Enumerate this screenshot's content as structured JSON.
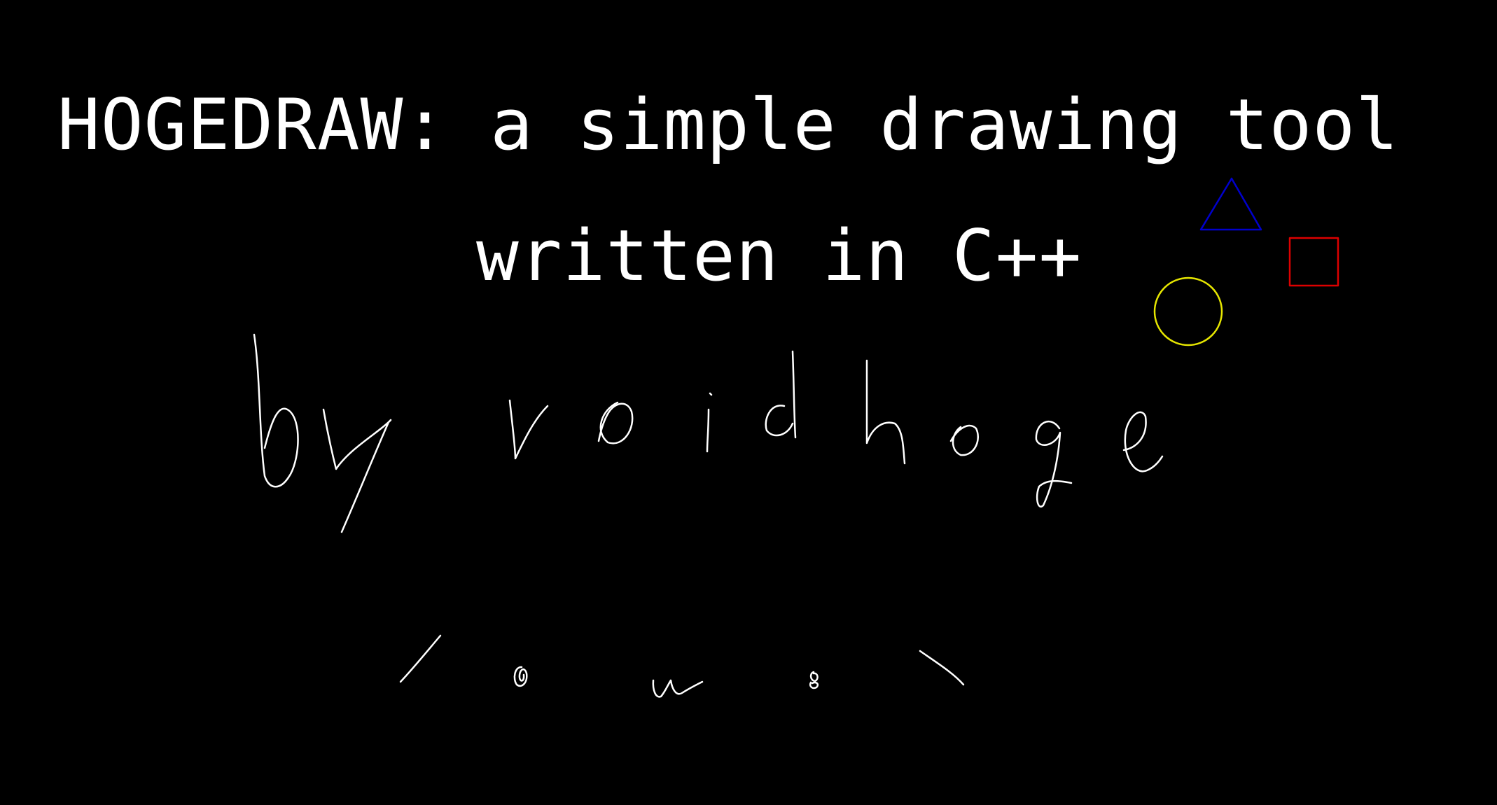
{
  "app": {
    "title_line_1": "HOGEDRAW: a simple drawing tool",
    "title_line_2": "written in C++"
  },
  "colors": {
    "background": "#000000",
    "text": "#ffffff",
    "freehand_stroke": "#ffffff",
    "triangle": "#0000cc",
    "rectangle": "#dd0000",
    "circle": "#e6e600"
  },
  "shapes": [
    "triangle-shape",
    "rectangle-shape",
    "circle-shape"
  ],
  "handwriting": {
    "signature_text": "by voidhoge",
    "face_text": "( o w o )"
  }
}
